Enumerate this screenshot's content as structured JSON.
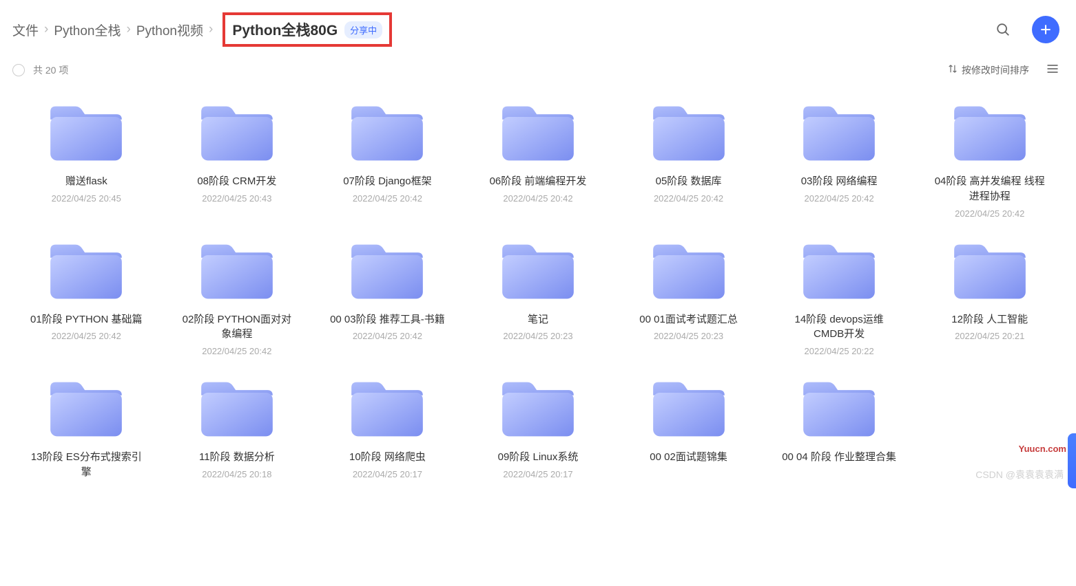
{
  "breadcrumb": {
    "root": "文件",
    "parent1": "Python全栈",
    "parent2": "Python视频",
    "current": "Python全栈80G",
    "share_badge": "分享中"
  },
  "toolbar": {
    "count_label": "共 20 项",
    "sort_label": "按修改时间排序"
  },
  "folders": [
    {
      "name": "赠送flask",
      "date": "2022/04/25 20:45"
    },
    {
      "name": "08阶段 CRM开发",
      "date": "2022/04/25 20:43"
    },
    {
      "name": "07阶段 Django框架",
      "date": "2022/04/25 20:42"
    },
    {
      "name": "06阶段 前端编程开发",
      "date": "2022/04/25 20:42"
    },
    {
      "name": "05阶段 数据库",
      "date": "2022/04/25 20:42"
    },
    {
      "name": "03阶段 网络编程",
      "date": "2022/04/25 20:42"
    },
    {
      "name": "04阶段 高并发编程 线程进程协程",
      "date": "2022/04/25 20:42"
    },
    {
      "name": "01阶段 PYTHON 基础篇",
      "date": "2022/04/25 20:42"
    },
    {
      "name": "02阶段 PYTHON面对对象编程",
      "date": "2022/04/25 20:42"
    },
    {
      "name": "00 03阶段 推荐工具-书籍",
      "date": "2022/04/25 20:42"
    },
    {
      "name": "笔记",
      "date": "2022/04/25 20:23"
    },
    {
      "name": "00 01面试考试题汇总",
      "date": "2022/04/25 20:23"
    },
    {
      "name": "14阶段 devops运维CMDB开发",
      "date": "2022/04/25 20:22"
    },
    {
      "name": "12阶段 人工智能",
      "date": "2022/04/25 20:21"
    },
    {
      "name": "13阶段 ES分布式搜索引擎",
      "date": ""
    },
    {
      "name": "11阶段 数据分析",
      "date": "2022/04/25 20:18"
    },
    {
      "name": "10阶段 网络爬虫",
      "date": "2022/04/25 20:17"
    },
    {
      "name": "09阶段 Linux系统",
      "date": "2022/04/25 20:17"
    },
    {
      "name": "00 02面试题锦集",
      "date": ""
    },
    {
      "name": "00 04 阶段 作业整理合集",
      "date": ""
    }
  ],
  "watermark": "CSDN @袁袁袁袁满",
  "corner_logo": "Yuucn.com"
}
